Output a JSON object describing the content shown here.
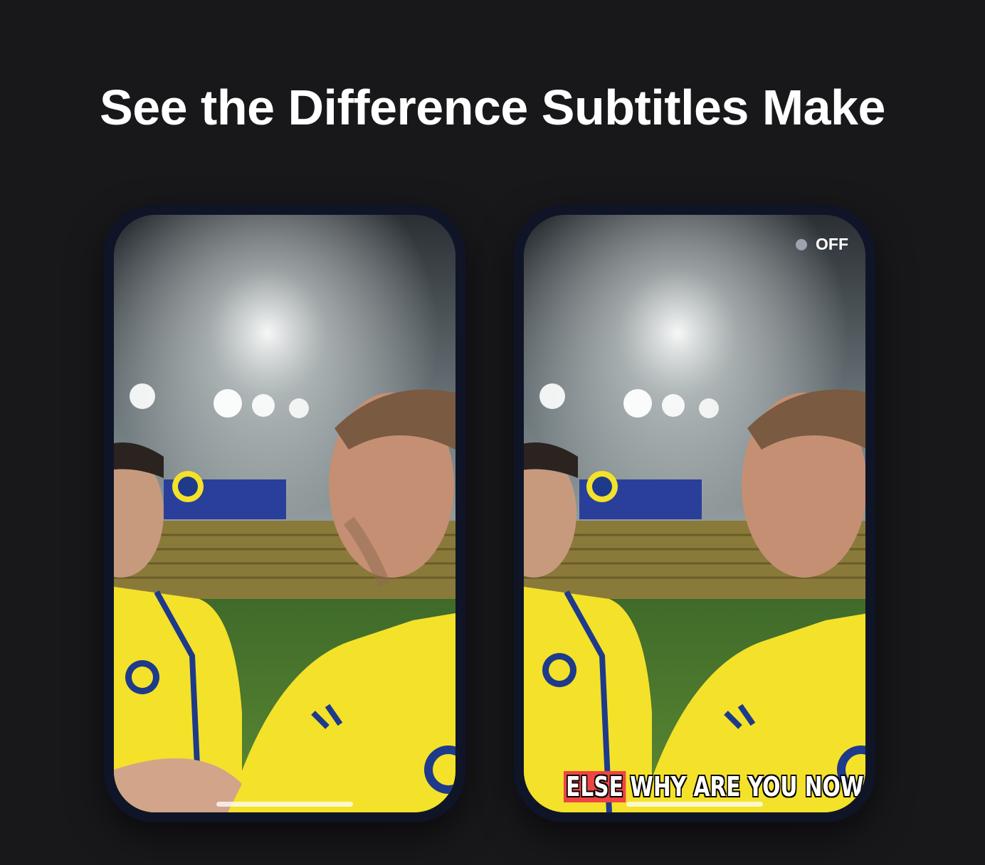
{
  "heading": "See the Difference Subtitles Make",
  "phones": {
    "left": {
      "caption": ""
    },
    "right": {
      "toggle_label": "OFF",
      "subtitle": {
        "highlighted_word": "ELSE",
        "rest": "WHY ARE YOU NOW"
      }
    }
  },
  "colors": {
    "background": "#18181b",
    "phone_frame": "#0f1526",
    "jersey": "#f4e12a",
    "subtitle_highlight": "#ef4444",
    "toggle_dot": "#9ca3af"
  }
}
